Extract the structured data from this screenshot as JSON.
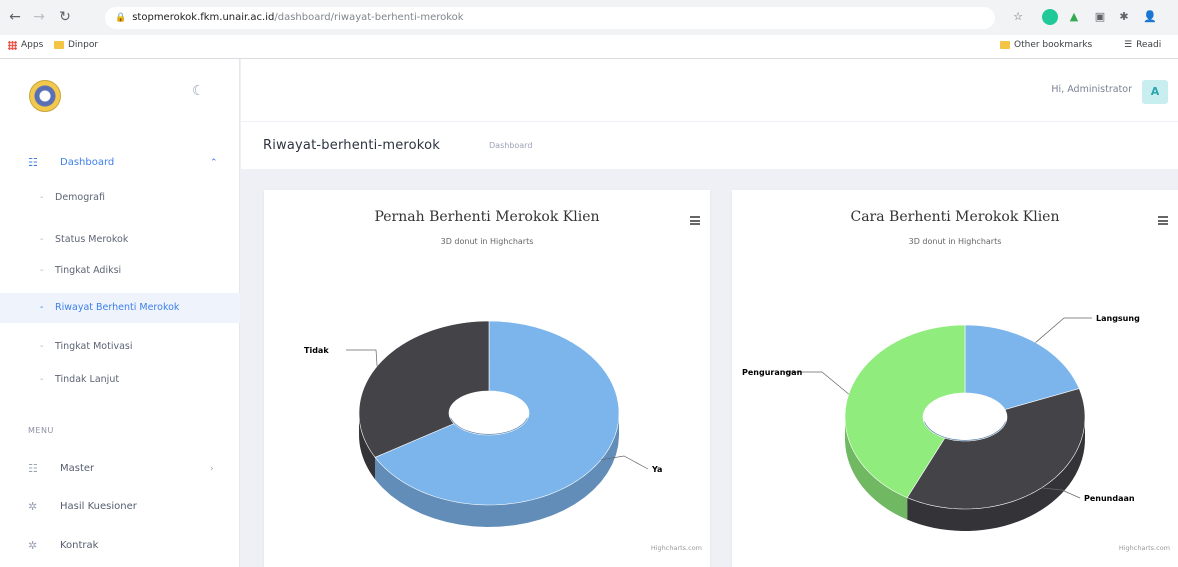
{
  "browser": {
    "url_host": "stopmerokok.fkm.unair.ac.id",
    "url_path": "/dashboard/riwayat-berhenti-merokok",
    "bookmarks": {
      "apps": "Apps",
      "folder": "Dinpor",
      "other": "Other bookmarks",
      "reading": "Readi"
    }
  },
  "sidebar": {
    "dashboard_label": "Dashboard",
    "sub_items": [
      {
        "label": "Demografi"
      },
      {
        "label": "Status Merokok"
      },
      {
        "label": "Tingkat Adiksi"
      },
      {
        "label": "Riwayat Berhenti Merokok"
      },
      {
        "label": "Tingkat Motivasi"
      },
      {
        "label": "Tindak Lanjut"
      }
    ],
    "menu_heading": "MENU",
    "menu_items": [
      {
        "label": "Master"
      },
      {
        "label": "Hasil Kuesioner"
      },
      {
        "label": "Kontrak"
      }
    ]
  },
  "header": {
    "greeting": "Hi, Administrator",
    "avatar_letter": "A"
  },
  "page": {
    "title": "Riwayat-berhenti-merokok",
    "breadcrumb": "Dashboard"
  },
  "colors": {
    "blue": "#7cb5ec",
    "dark": "#434348",
    "green": "#90ed7d",
    "accent": "#3f80ea"
  },
  "chart_data": [
    {
      "type": "pie",
      "title": "Pernah Berhenti Merokok Klien",
      "subtitle": "3D donut in Highcharts",
      "credits": "Highcharts.com",
      "slices": [
        {
          "name": "Ya",
          "value": 67,
          "color": "#7cb5ec"
        },
        {
          "name": "Tidak",
          "value": 33,
          "color": "#434348"
        }
      ]
    },
    {
      "type": "pie",
      "title": "Cara Berhenti Merokok Klien",
      "subtitle": "3D donut in Highcharts",
      "credits": "Highcharts.com",
      "slices": [
        {
          "name": "Langsung",
          "value": 20,
          "color": "#7cb5ec"
        },
        {
          "name": "Penundaan",
          "value": 38,
          "color": "#434348"
        },
        {
          "name": "Pengurangan",
          "value": 42,
          "color": "#90ed7d"
        }
      ]
    }
  ]
}
